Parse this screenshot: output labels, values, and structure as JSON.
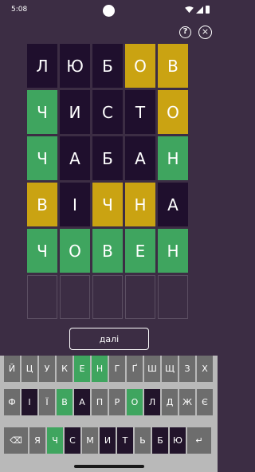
{
  "status_bar": {
    "time": "5:08"
  },
  "header": {
    "help_icon": "?",
    "close_icon": "×"
  },
  "board": {
    "rows": [
      [
        {
          "letter": "Л",
          "state": "absent"
        },
        {
          "letter": "Ю",
          "state": "absent"
        },
        {
          "letter": "Б",
          "state": "absent"
        },
        {
          "letter": "О",
          "state": "present"
        },
        {
          "letter": "В",
          "state": "present"
        }
      ],
      [
        {
          "letter": "Ч",
          "state": "correct"
        },
        {
          "letter": "И",
          "state": "absent"
        },
        {
          "letter": "С",
          "state": "absent"
        },
        {
          "letter": "Т",
          "state": "absent"
        },
        {
          "letter": "О",
          "state": "present"
        }
      ],
      [
        {
          "letter": "Ч",
          "state": "correct"
        },
        {
          "letter": "А",
          "state": "absent"
        },
        {
          "letter": "Б",
          "state": "absent"
        },
        {
          "letter": "А",
          "state": "absent"
        },
        {
          "letter": "Н",
          "state": "correct"
        }
      ],
      [
        {
          "letter": "В",
          "state": "present"
        },
        {
          "letter": "І",
          "state": "absent"
        },
        {
          "letter": "Ч",
          "state": "present"
        },
        {
          "letter": "Н",
          "state": "present"
        },
        {
          "letter": "А",
          "state": "absent"
        }
      ],
      [
        {
          "letter": "Ч",
          "state": "correct"
        },
        {
          "letter": "О",
          "state": "correct"
        },
        {
          "letter": "В",
          "state": "correct"
        },
        {
          "letter": "Е",
          "state": "correct"
        },
        {
          "letter": "Н",
          "state": "correct"
        }
      ],
      [
        {
          "letter": "",
          "state": "empty"
        },
        {
          "letter": "",
          "state": "empty"
        },
        {
          "letter": "",
          "state": "empty"
        },
        {
          "letter": "",
          "state": "empty"
        },
        {
          "letter": "",
          "state": "empty"
        }
      ]
    ]
  },
  "next_button": {
    "label": "далі"
  },
  "keyboard": {
    "rows": [
      [
        {
          "key": "Й",
          "state": "light"
        },
        {
          "key": "Ц",
          "state": "light"
        },
        {
          "key": "У",
          "state": "light"
        },
        {
          "key": "К",
          "state": "light"
        },
        {
          "key": "Е",
          "state": "correct"
        },
        {
          "key": "Н",
          "state": "correct"
        },
        {
          "key": "Г",
          "state": "light"
        },
        {
          "key": "Ґ",
          "state": "light"
        },
        {
          "key": "Ш",
          "state": "light"
        },
        {
          "key": "Щ",
          "state": "light"
        },
        {
          "key": "З",
          "state": "light"
        },
        {
          "key": "Х",
          "state": "light"
        }
      ],
      [
        {
          "key": "Ф",
          "state": "light"
        },
        {
          "key": "І",
          "state": "dark"
        },
        {
          "key": "Ї",
          "state": "light"
        },
        {
          "key": "В",
          "state": "correct"
        },
        {
          "key": "А",
          "state": "dark"
        },
        {
          "key": "П",
          "state": "light"
        },
        {
          "key": "Р",
          "state": "light"
        },
        {
          "key": "О",
          "state": "correct"
        },
        {
          "key": "Л",
          "state": "dark"
        },
        {
          "key": "Д",
          "state": "light"
        },
        {
          "key": "Ж",
          "state": "light"
        },
        {
          "key": "Є",
          "state": "light"
        }
      ],
      [
        {
          "key": "⌫",
          "state": "light",
          "icon": "backspace-icon"
        },
        {
          "key": "Я",
          "state": "light"
        },
        {
          "key": "Ч",
          "state": "correct"
        },
        {
          "key": "С",
          "state": "dark"
        },
        {
          "key": "М",
          "state": "light"
        },
        {
          "key": "И",
          "state": "dark"
        },
        {
          "key": "Т",
          "state": "dark"
        },
        {
          "key": "Ь",
          "state": "light"
        },
        {
          "key": "Б",
          "state": "dark"
        },
        {
          "key": "Ю",
          "state": "dark"
        },
        {
          "key": "↵",
          "state": "light",
          "icon": "enter-icon"
        }
      ]
    ]
  },
  "colors": {
    "background": "#3c2d44",
    "correct": "#3fa55f",
    "present": "#caa312",
    "absent": "#1f0f2d",
    "key_light": "#6d6d6d",
    "keyboard_bg": "#b9b9b9"
  }
}
